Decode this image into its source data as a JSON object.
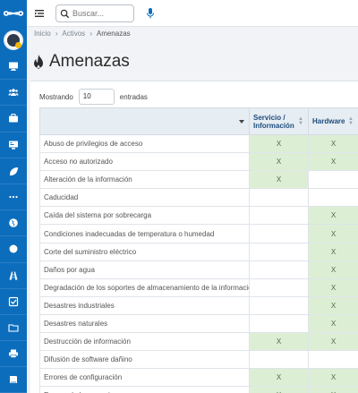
{
  "search": {
    "placeholder": "Buscar..."
  },
  "breadcrumb": [
    "Inicio",
    "Activos",
    "Amenazas"
  ],
  "page": {
    "title": "Amenazas"
  },
  "table_controls": {
    "show_label": "Mostrando",
    "entries_value": "10",
    "entries_label": "entradas"
  },
  "table": {
    "columns": [
      "",
      "Servicio / Información",
      "Hardware"
    ],
    "rows": [
      {
        "name": "Abuso de privilegios de acceso",
        "servicio": "X",
        "hardware": "X"
      },
      {
        "name": "Acceso no autorizado",
        "servicio": "X",
        "hardware": "X"
      },
      {
        "name": "Alteración de la información",
        "servicio": "X",
        "hardware": ""
      },
      {
        "name": "Caducidad",
        "servicio": "",
        "hardware": ""
      },
      {
        "name": "Caída del sistema por sobrecarga",
        "servicio": "",
        "hardware": "X"
      },
      {
        "name": "Condiciones inadecuadas de temperatura o humedad",
        "servicio": "",
        "hardware": "X"
      },
      {
        "name": "Corte del suministro eléctrico",
        "servicio": "",
        "hardware": "X"
      },
      {
        "name": "Daños por agua",
        "servicio": "",
        "hardware": "X"
      },
      {
        "name": "Degradación de los soportes de almacenamiento de la información",
        "servicio": "",
        "hardware": "X"
      },
      {
        "name": "Desastres industriales",
        "servicio": "",
        "hardware": "X"
      },
      {
        "name": "Desastres naturales",
        "servicio": "",
        "hardware": "X"
      },
      {
        "name": "Destrucción de información",
        "servicio": "X",
        "hardware": "X"
      },
      {
        "name": "Difusión de software dañino",
        "servicio": "",
        "hardware": ""
      },
      {
        "name": "Errores de configuración",
        "servicio": "X",
        "hardware": "X"
      },
      {
        "name": "Errores de los usuarios",
        "servicio": "X",
        "hardware": "X"
      }
    ]
  },
  "colors": {
    "sidebar": "#0d6dbd",
    "mark_bg": "#dcefd5",
    "header_bg": "#e6edf3",
    "flame": "#2b2b2b"
  },
  "icons": {
    "sidebar": [
      "monitor-icon",
      "users-icon",
      "briefcase-icon",
      "dashboard-icon",
      "leaf-icon",
      "more-icon",
      "globe-icon",
      "circle-icon",
      "road-icon",
      "checkbox-icon",
      "folder-icon",
      "print-icon",
      "book-icon"
    ]
  }
}
